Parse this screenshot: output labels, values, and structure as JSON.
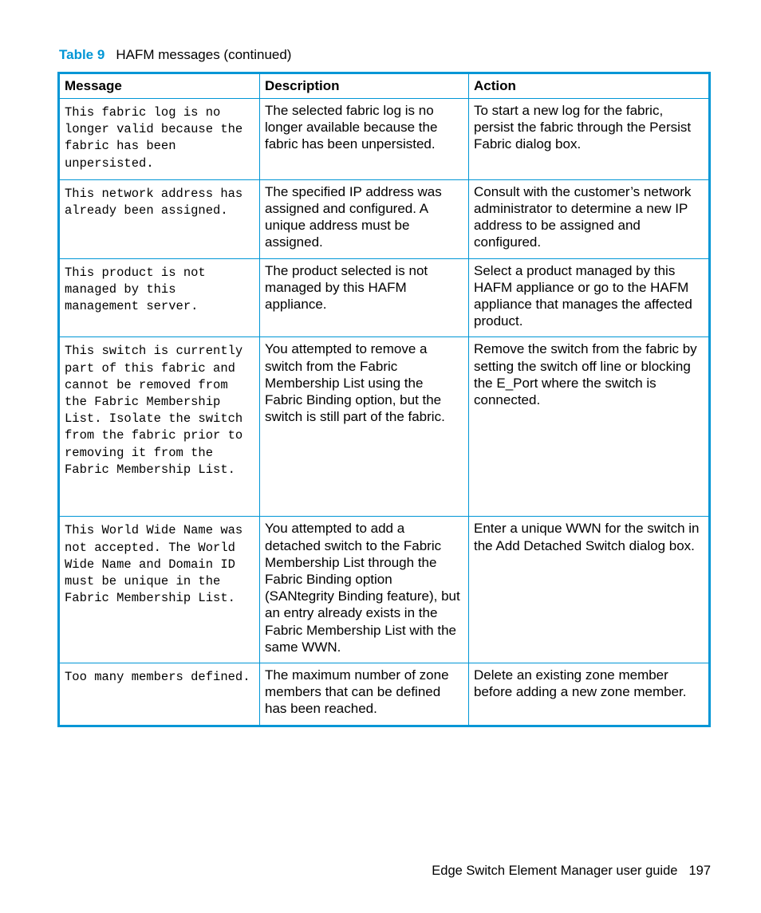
{
  "caption": {
    "label": "Table 9",
    "title": "HAFM messages (continued)"
  },
  "table": {
    "headers": [
      "Message",
      "Description",
      "Action"
    ],
    "rows": [
      {
        "message": "This fabric log is no longer valid because the fabric has been unpersisted.",
        "description": "The selected fabric log is no longer available because the fabric has been unpersisted.",
        "action": "To start a new log for the fabric, persist the fabric through the Persist Fabric dialog box."
      },
      {
        "message": "This network address has already been assigned.",
        "description": "The specified IP address was assigned and configured. A unique address must be assigned.",
        "action": "Consult with the customer’s network administrator to determine a new IP address to be assigned and configured."
      },
      {
        "message": "This product is not managed by this management server.",
        "description": "The product selected is not managed by this HAFM appliance.",
        "action": "Select a product managed by this HAFM appliance or go to the HAFM appliance that manages the affected product."
      },
      {
        "message": "This switch is currently part of this fabric and cannot be removed from the Fabric Membership List. Isolate the switch from the fabric prior to removing it from the Fabric Membership List.",
        "description": "You attempted to remove a switch from the Fabric Membership List using the Fabric Binding option, but the switch is still part of the fabric.",
        "action": "Remove the switch from the fabric by setting the switch off line or blocking the E_Port where the switch is connected."
      },
      {
        "message": "This World Wide Name was not accepted. The World Wide Name and Domain ID must be unique in the Fabric Membership List.",
        "description": "You attempted to add a detached switch to the Fabric Membership List through the Fabric Binding option (SANtegrity Binding feature), but an entry already exists in the Fabric Membership List with the same WWN.",
        "action": "Enter a unique WWN for the switch in the Add Detached Switch dialog box."
      },
      {
        "message": "Too many members defined.",
        "description": "The maximum number of zone members that can be defined has been reached.",
        "action": "Delete an existing zone member before adding a new zone member."
      }
    ]
  },
  "footer": {
    "guide_title": "Edge Switch Element Manager user guide",
    "page_number": "197"
  },
  "colors": {
    "accent": "#0096d6"
  }
}
